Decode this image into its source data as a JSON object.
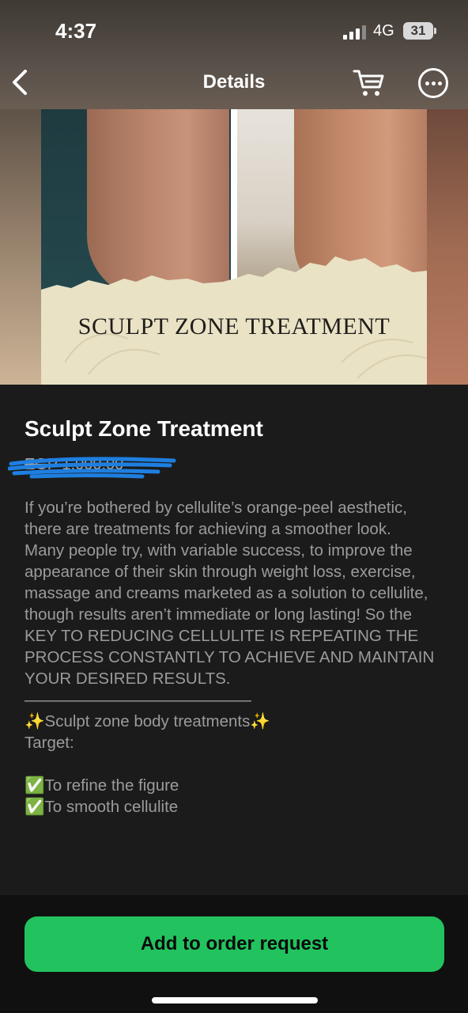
{
  "status_bar": {
    "time": "4:37",
    "network": "4G",
    "battery": "31"
  },
  "nav": {
    "title": "Details",
    "back_icon": "chevron-left-icon",
    "cart_icon": "cart-icon",
    "more_icon": "more-horizontal-icon"
  },
  "hero": {
    "caption": "SCULPT ZONE TREATMENT"
  },
  "product": {
    "title": "Sculpt Zone Treatment",
    "price": "EGP 1,000.00",
    "description": "If you’re bothered by cellulite’s orange-peel aesthetic, there are treatments for achieving a smoother look.\nMany people try, with variable success, to improve the appearance of their skin through weight loss, exercise, massage and creams marketed as a solution to cellulite, though results aren’t immediate or long lasting! So the KEY TO REDUCING CELLULITE IS REPEATING THE PROCESS CONSTANTLY TO ACHIEVE AND MAINTAIN YOUR DESIRED RESULTS.\n——————————————\n✨Sculpt zone body treatments✨\nTarget:\n\n✅To refine the figure\n✅To smooth cellulite"
  },
  "actions": {
    "order_label": "Add to order request"
  },
  "colors": {
    "accent": "#22c35e",
    "background": "#1b1b1b",
    "scribble": "#1e7fe0"
  }
}
